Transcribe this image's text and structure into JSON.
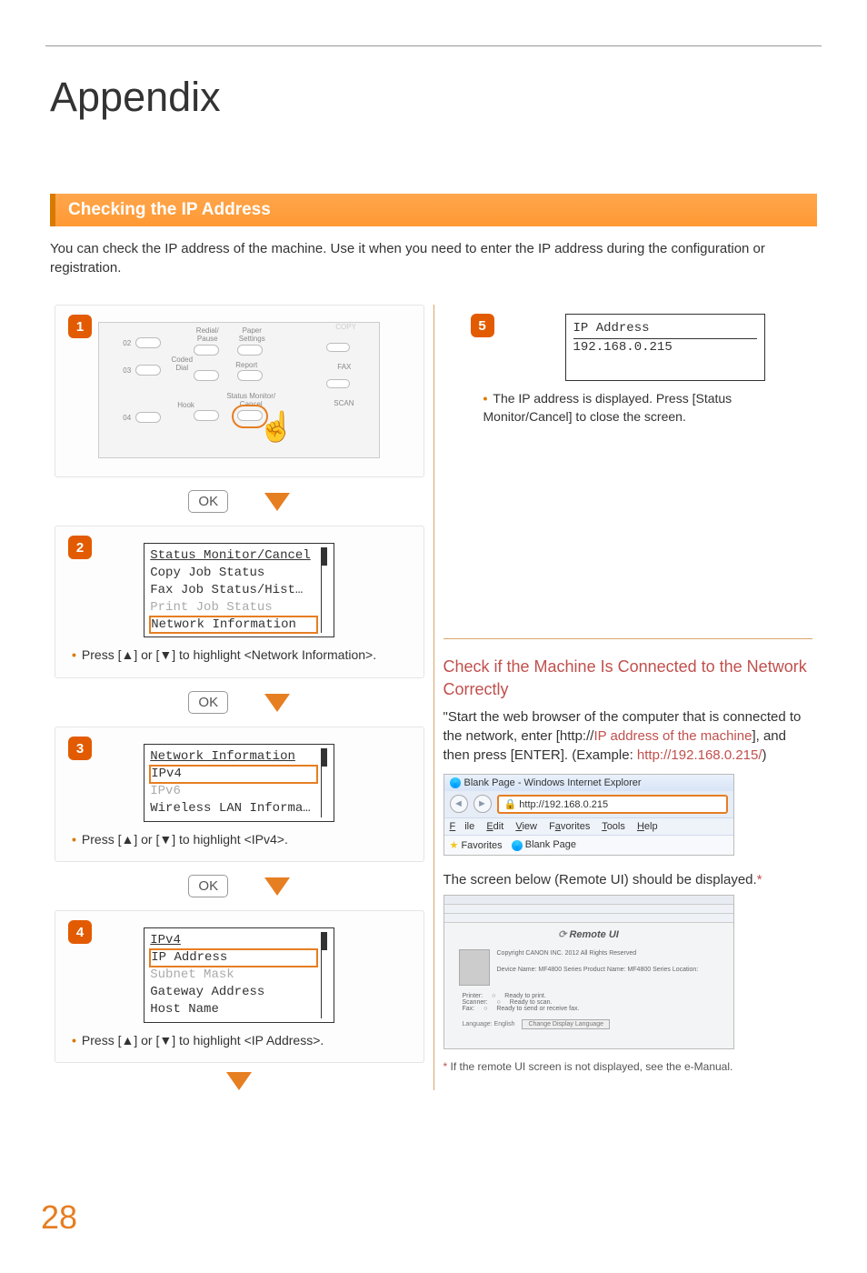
{
  "page": {
    "title": "Appendix",
    "number": "28"
  },
  "section": {
    "title": "Checking the IP Address"
  },
  "intro": "You can check the IP address of the machine. Use it when you need to enter the IP address during the configuration or registration.",
  "steps": {
    "s1": {
      "num": "1",
      "panel_labels": {
        "n02": "02",
        "n03": "03",
        "n04": "04",
        "redial": "Redial/\nPause",
        "paper": "Paper\nSettings",
        "copy": "COPY",
        "coded": "Coded\nDial",
        "report": "Report",
        "fax": "FAX",
        "hook": "Hook",
        "smc": "Status Monitor/\nCancel",
        "scan": "SCAN"
      }
    },
    "s2": {
      "num": "2",
      "lcd": {
        "title": "Status Monitor/Cancel",
        "l1": "Copy Job Status",
        "l2": "Fax Job Status/Hist…",
        "l3": "Print Job Status",
        "hl": "Network Information"
      },
      "note": "Press [▲] or [▼] to highlight <Network Information>."
    },
    "s3": {
      "num": "3",
      "lcd": {
        "title": "Network Information",
        "hl": "IPv4",
        "fade": "IPv6",
        "l2": "Wireless LAN Informa…"
      },
      "note": "Press [▲] or [▼] to highlight <IPv4>."
    },
    "s4": {
      "num": "4",
      "lcd": {
        "title": "IPv4",
        "hl": "IP Address",
        "fade": "Subnet Mask",
        "l2": "Gateway Address",
        "l3": "Host Name"
      },
      "note": "Press [▲] or [▼] to highlight <IP Address>."
    },
    "s5": {
      "num": "5",
      "lcd": {
        "title": "IP Address",
        "value": "192.168.0.215"
      },
      "note": "The IP address is displayed. Press [Status Monitor/Cancel] to close the screen."
    }
  },
  "ok_label": "OK",
  "subsection": {
    "heading": "Check if the Machine Is Connected to the Network Correctly",
    "body_plain_1": "\"Start the web browser of the computer that is connected to the network, enter [http://",
    "body_red_1": "IP address of the machine",
    "body_plain_2": "], and then press [ENTER]. (Example: ",
    "body_red_2": "http://192.168.0.215/",
    "body_plain_3": ")",
    "ie": {
      "title": "Blank Page - Windows Internet Explorer",
      "url": "http://192.168.0.215",
      "menu": {
        "file": "File",
        "edit": "Edit",
        "view": "View",
        "fav": "Favorites",
        "tools": "Tools",
        "help": "Help"
      },
      "favorites": "Favorites",
      "blank": "Blank Page"
    },
    "caption2": "The screen below (Remote UI) should be displayed.",
    "remoteui": {
      "header": "Remote UI",
      "dev_lines": "Device Name: MF4800 Series\nProduct Name: MF4800 Series\nLocation:",
      "copy": "Copyright CANON INC. 2012\nAll Rights Reserved",
      "status": {
        "printer_l": "Printer:",
        "printer_v": "Ready to print.",
        "scanner_l": "Scanner:",
        "scanner_v": "Ready to scan.",
        "fax_l": "Fax:",
        "fax_v": "Ready to send or receive fax."
      },
      "lang_l": "Language:",
      "lang_v": "English",
      "lang_btn": "Change Display Language"
    },
    "footnote": "If the remote UI screen is not displayed, see the e-Manual."
  }
}
